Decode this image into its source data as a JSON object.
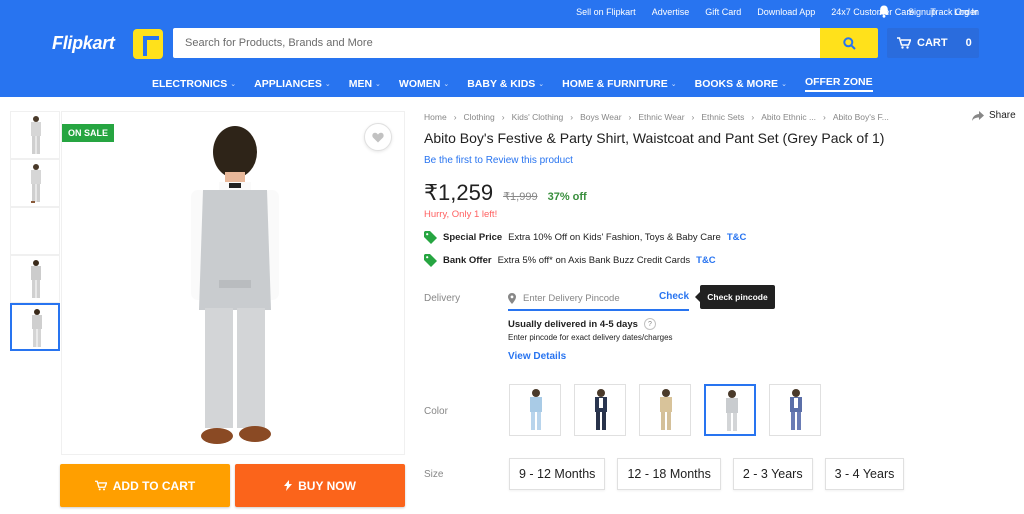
{
  "header": {
    "logo": "Flipkart",
    "top_links": [
      "Sell on Flipkart",
      "Advertise",
      "Gift Card",
      "Download App",
      "24x7 Customer Care",
      "Track Order"
    ],
    "signup": "Signup",
    "login": "Log In",
    "search_placeholder": "Search for Products, Brands and More",
    "cart_label": "CART",
    "cart_count": "0",
    "categories": [
      "ELECTRONICS",
      "APPLIANCES",
      "MEN",
      "WOMEN",
      "BABY & KIDS",
      "HOME & FURNITURE",
      "BOOKS & MORE",
      "OFFER ZONE"
    ],
    "brand_color": "#2874f0",
    "accent_color": "#ffe11b"
  },
  "gallery": {
    "badge": "ON SALE",
    "thumb_count_selected_index": 4
  },
  "actions": {
    "add_to_cart": "ADD TO CART",
    "buy_now": "BUY NOW"
  },
  "product": {
    "breadcrumb": [
      "Home",
      "Clothing",
      "Kids' Clothing",
      "Boys Wear",
      "Ethnic Wear",
      "Ethnic Sets",
      "Abito Ethnic ...",
      "Abito Boy's F..."
    ],
    "share": "Share",
    "title": "Abito Boy's Festive & Party Shirt, Waistcoat and Pant Set  (Grey Pack of 1)",
    "review_link": "Be the first to Review this product",
    "price": "₹1,259",
    "mrp": "₹1,999",
    "discount": "37% off",
    "stock_note": "Hurry, Only 1 left!",
    "offers": [
      {
        "title": "Special Price",
        "text": "Extra 10% Off on Kids' Fashion, Toys & Baby Care",
        "tc": "T&C"
      },
      {
        "title": "Bank Offer",
        "text": "Extra 5% off* on Axis Bank Buzz Credit Cards",
        "tc": "T&C"
      }
    ]
  },
  "delivery": {
    "label": "Delivery",
    "pincode_placeholder": "Enter Delivery Pincode",
    "check": "Check",
    "tooltip": "Check pincode",
    "estimate": "Usually delivered in 4-5 days",
    "note": "Enter pincode for exact delivery dates/charges",
    "view_details": "View Details"
  },
  "color": {
    "label": "Color",
    "options": [
      "light-blue",
      "navy",
      "beige",
      "grey",
      "blue"
    ],
    "selected_index": 3
  },
  "size": {
    "label": "Size",
    "options": [
      "9 - 12 Months",
      "12 - 18 Months",
      "2 - 3 Years",
      "3 - 4 Years"
    ]
  }
}
